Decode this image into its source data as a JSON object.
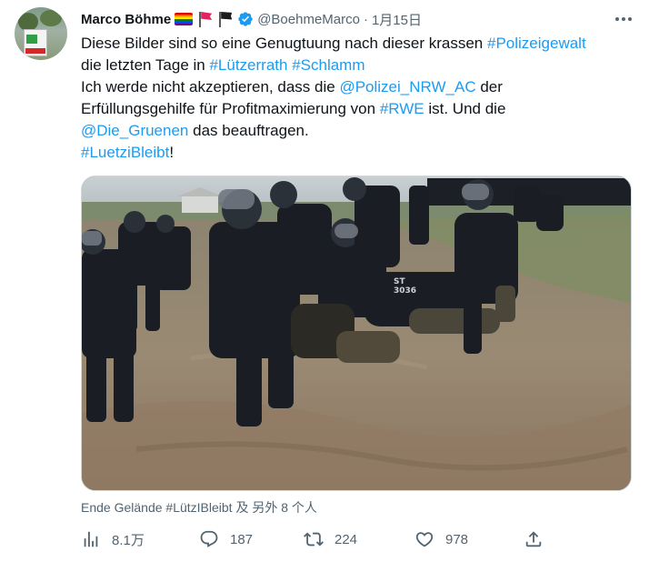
{
  "tweet": {
    "author": {
      "display_name": "Marco Böhme",
      "handle": "@BoehmeMarco",
      "emojis": [
        "rainbow-flag",
        "red-flag",
        "black-flag"
      ],
      "verified": true
    },
    "separator": "·",
    "time": "1月15日",
    "text_lines": [
      [
        {
          "t": "Diese Bilder sind so eine Genugtuung nach dieser krassen "
        },
        {
          "t": "#Polizeigewalt",
          "link": true
        }
      ],
      [
        {
          "t": "die letzten Tage in "
        },
        {
          "t": "#Lützerrath",
          "link": true
        },
        {
          "t": " "
        },
        {
          "t": "#Schlamm",
          "link": true
        }
      ],
      [
        {
          "t": "Ich werde nicht akzeptieren, dass die "
        },
        {
          "t": "@Polizei_NRW_AC",
          "link": true
        },
        {
          "t": " der"
        }
      ],
      [
        {
          "t": "Erfüllungsgehilfe für Profitmaximierung von "
        },
        {
          "t": "#RWE",
          "link": true
        },
        {
          "t": " ist. Und die"
        }
      ],
      [
        {
          "t": "@Die_Gruenen",
          "link": true
        },
        {
          "t": " das beauftragen."
        }
      ],
      [
        {
          "t": "#LuetziBleibt",
          "link": true
        },
        {
          "t": "!"
        }
      ]
    ],
    "media": {
      "subject": "police-in-mud-photo"
    },
    "tagged": "Ende Gelände #LützIBleibt 及 另外 8 个人",
    "actions": {
      "views": "8.1万",
      "replies": "187",
      "retweets": "224",
      "likes": "978"
    },
    "colors": {
      "link": "#1d9bf0",
      "secondary": "#536471",
      "verified": "#1d9bf0"
    }
  }
}
